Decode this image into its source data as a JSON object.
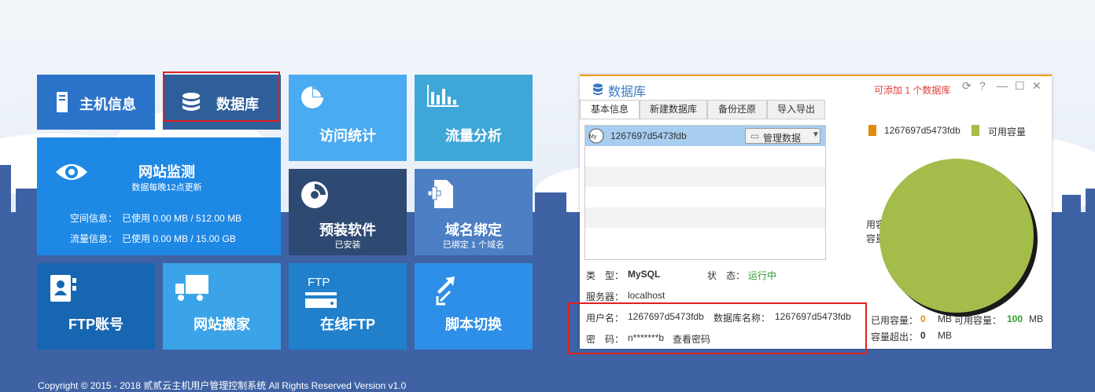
{
  "tiles": {
    "host_info": "主机信息",
    "database": "数据库",
    "visit_stats": "访问统计",
    "traffic": "流量分析",
    "monitor_title": "网站监测",
    "monitor_sub": "数据每晚12点更新",
    "space_label": "空间信息：",
    "space_value": "已使用 0.00 MB / 512.00 MB",
    "flow_label": "流量信息：",
    "flow_value": "已使用 0.00 MB / 15.00 GB",
    "preinstall": "预装软件",
    "preinstall_sub": "已安装",
    "domain": "域名绑定",
    "domain_sub": "已绑定 1 个域名",
    "ftp_account": "FTP账号",
    "site_move": "网站搬家",
    "ftp_caption": "FTP",
    "online_ftp": "在线FTP",
    "script_switch": "脚本切换"
  },
  "copyright": "Copyright © 2015 - 2018 贰贰云主机用户管理控制系统 All Rights Reserved Version v1.0",
  "panel": {
    "title": "数据库",
    "note": "可添加 1 个数据库",
    "tabs": [
      "基本信息",
      "新建数据库",
      "备份还原",
      "导入导出"
    ],
    "db_name": "1267697d5473fdb",
    "manage_button": "管理数据",
    "type_label": "类　型：",
    "type_value": "MySQL",
    "status_label": "状　态：",
    "status_value": "运行中",
    "server_label": "服务器：",
    "server_value": "localhost",
    "user_label": "用户名：",
    "user_value": "1267697d5473fdb",
    "dbname_label": "数据库名称：",
    "dbname_value": "1267697d5473fdb",
    "pwd_label": "密　码：",
    "pwd_value": "n*******b",
    "view_pwd": "查看密码",
    "legend_db": "1267697d5473fdb",
    "legend_avail": "可用容量",
    "pie_label1": "可用容量：100 MB",
    "pie_label2": "总容量：100%",
    "used_label": "已用容量：",
    "used_value": "0",
    "mb1": "MB",
    "avail_label": "可用容量：",
    "avail_value": "100",
    "mb2": "MB",
    "over_label": "容量超出：",
    "over_value": "0",
    "mb3": "MB"
  },
  "colors": {
    "accent_orange": "#f39c12",
    "pie": "#a4bc4a",
    "highlight": "#e02020",
    "status_green": "#2e9e2e"
  }
}
